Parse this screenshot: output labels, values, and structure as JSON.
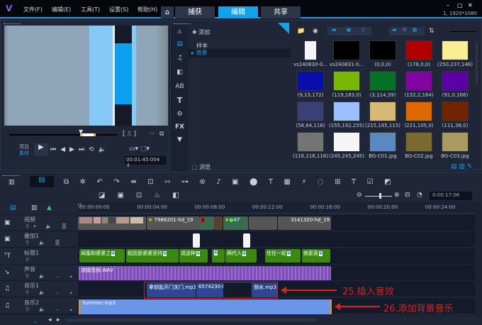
{
  "app": {
    "menu": [
      "文件(F)",
      "编辑(E)",
      "工具(T)",
      "设置(S)",
      "帮助(H)"
    ],
    "tabs": [
      "捕获",
      "编辑",
      "共享"
    ],
    "active_tab": "编辑",
    "resolution": "1, 1920*1080",
    "accent": "#10a2ee"
  },
  "preview": {
    "mode_project": "项目",
    "mode_clip": "素材",
    "timecode": "00:01:45:004"
  },
  "library": {
    "add_label": "添加",
    "folders": [
      "样本",
      "背景"
    ],
    "selected_folder": "背景",
    "browse_label": "浏览",
    "items": [
      {
        "label": "vs240830-0...",
        "color": "#f4f4f4"
      },
      {
        "label": "vs240831-0...",
        "color": "#000000"
      },
      {
        "label": "(0,0,0)",
        "color": "#000000"
      },
      {
        "label": "(178,0,0)",
        "color": "#b20000"
      },
      {
        "label": "(250,237,146)",
        "color": "#faed92"
      },
      {
        "label": "(9,13,172)",
        "color": "#090dac"
      },
      {
        "label": "(119,183,0)",
        "color": "#77b700"
      },
      {
        "label": "(3,114,39)",
        "color": "#037227"
      },
      {
        "label": "(132,2,164)",
        "color": "#8402a4"
      },
      {
        "label": "(91,0,166)",
        "color": "#5b00a6"
      },
      {
        "label": "(58,64,116)",
        "color": "#3a4074"
      },
      {
        "label": "(155,192,255)",
        "color": "#9bc0ff"
      },
      {
        "label": "(215,185,115)",
        "color": "#d7b973"
      },
      {
        "label": "(221,105,0)",
        "color": "#dd6900"
      },
      {
        "label": "(111,38,0)",
        "color": "#6f2600"
      },
      {
        "label": "(116,116,116)",
        "color": "#747474"
      },
      {
        "label": "(245,245,245)",
        "color": "#f5f5f5"
      },
      {
        "label": "BG-C01.jpg",
        "color": "#5a88c0"
      },
      {
        "label": "BG-C02.jpg",
        "color": "#7a6a30"
      },
      {
        "label": "BG-C03.jpg",
        "color": "#a89a60"
      }
    ]
  },
  "timeline": {
    "zoom_timecode": "0:00:17:06",
    "ruler": [
      "00:00:00:00",
      "00:00:04:00",
      "00:00:08:00",
      "00:00:12:00",
      "00:00:16:00",
      "00:00:20:00",
      "00:00:24:00"
    ],
    "tracks": [
      "视频",
      "叠加1",
      "标题1",
      "声音",
      "音乐1",
      "音乐2"
    ],
    "video_clips": [
      "7986201-hd_19",
      "47",
      "3141320-hd_19"
    ],
    "title_clips": [
      "闺蜜和婆婆之",
      "起因是婆婆坚持",
      "说这种",
      "",
      "两代人",
      "住在一起",
      "她更喜"
    ],
    "voice_clip": "诗婧音频.WAV",
    "music1_clips": [
      "拿钥匙开门关门.mp3",
      "6574230-h",
      "倒水.mp3"
    ],
    "music2_clip": "Summer.mp3"
  },
  "annotations": [
    "25.插入音效",
    "26.添加背景音乐"
  ]
}
